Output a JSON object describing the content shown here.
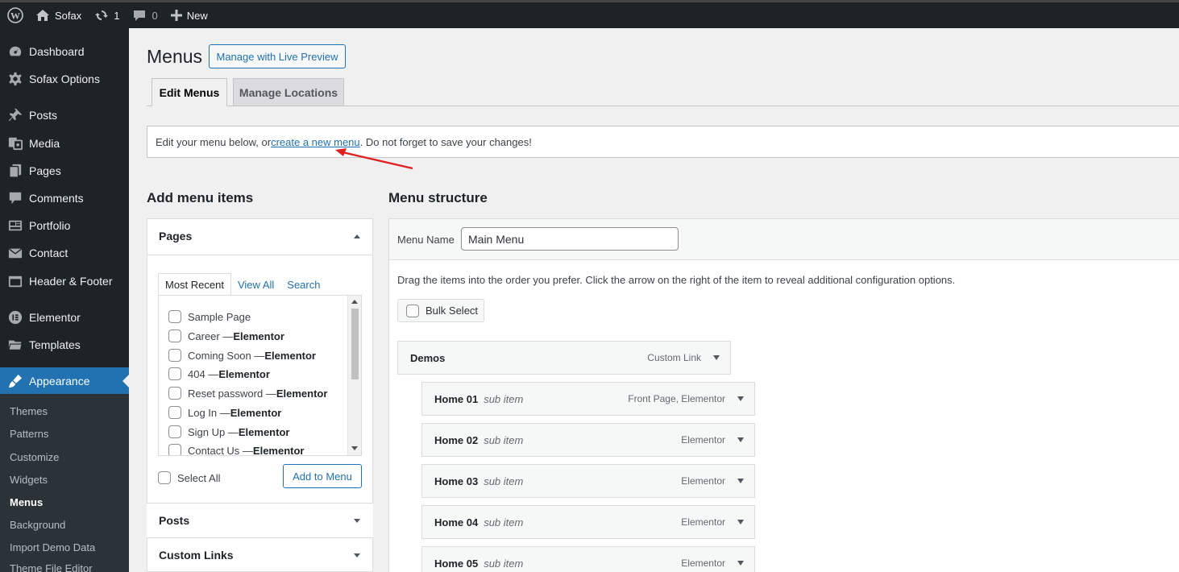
{
  "adminbar": {
    "site_name": "Sofax",
    "updates_count": "1",
    "comments_count": "0",
    "new_label": "New"
  },
  "sidebar": {
    "items": [
      {
        "label": "Dashboard",
        "icon": "dashboard-icon"
      },
      {
        "label": "Sofax Options",
        "icon": "gear-icon"
      },
      {
        "label": "Posts",
        "icon": "pin-icon"
      },
      {
        "label": "Media",
        "icon": "media-icon"
      },
      {
        "label": "Pages",
        "icon": "pages-icon"
      },
      {
        "label": "Comments",
        "icon": "comment-icon"
      },
      {
        "label": "Portfolio",
        "icon": "portfolio-icon"
      },
      {
        "label": "Contact",
        "icon": "envelope-icon"
      },
      {
        "label": "Header & Footer",
        "icon": "header-footer-icon"
      },
      {
        "label": "Elementor",
        "icon": "elementor-icon"
      },
      {
        "label": "Templates",
        "icon": "folder-icon"
      },
      {
        "label": "Appearance",
        "icon": "brush-icon"
      }
    ],
    "submenu": [
      "Themes",
      "Patterns",
      "Customize",
      "Widgets",
      "Menus",
      "Background",
      "Import Demo Data",
      "Theme File Editor"
    ]
  },
  "page": {
    "title": "Menus",
    "live_preview_button": "Manage with Live Preview",
    "tabs": [
      "Edit Menus",
      "Manage Locations"
    ],
    "notice_before": "Edit your menu below, or ",
    "notice_link": "create a new menu",
    "notice_after": ". Do not forget to save your changes!"
  },
  "add_items": {
    "heading": "Add menu items",
    "pages_label": "Pages",
    "tabs": [
      "Most Recent",
      "View All",
      "Search"
    ],
    "pages": [
      {
        "title": "Sample Page",
        "suffix": ""
      },
      {
        "title": "Career — ",
        "suffix": "Elementor"
      },
      {
        "title": "Coming Soon — ",
        "suffix": "Elementor"
      },
      {
        "title": "404 — ",
        "suffix": "Elementor"
      },
      {
        "title": "Reset password — ",
        "suffix": "Elementor"
      },
      {
        "title": "Log In — ",
        "suffix": "Elementor"
      },
      {
        "title": "Sign Up — ",
        "suffix": "Elementor"
      },
      {
        "title": "Contact Us — ",
        "suffix": "Elementor"
      }
    ],
    "select_all": "Select All",
    "add_to_menu": "Add to Menu",
    "posts_label": "Posts",
    "custom_links_label": "Custom Links"
  },
  "structure": {
    "heading": "Menu structure",
    "menu_name_label": "Menu Name",
    "menu_name_value": "Main Menu",
    "instructions": "Drag the items into the order you prefer. Click the arrow on the right of the item to reveal additional configuration options.",
    "bulk_select": "Bulk Select",
    "items": [
      {
        "title": "Demos",
        "sub": "",
        "type": "Custom Link"
      },
      {
        "title": "Home 01",
        "sub": "sub item",
        "type": "Front Page, Elementor"
      },
      {
        "title": "Home 02",
        "sub": "sub item",
        "type": "Elementor"
      },
      {
        "title": "Home 03",
        "sub": "sub item",
        "type": "Elementor"
      },
      {
        "title": "Home 04",
        "sub": "sub item",
        "type": "Elementor"
      },
      {
        "title": "Home 05",
        "sub": "sub item",
        "type": "Elementor"
      }
    ]
  },
  "colors": {
    "admin_dark": "#1d2327",
    "accent_blue": "#2271b1",
    "annotation_red": "#e0201e"
  }
}
